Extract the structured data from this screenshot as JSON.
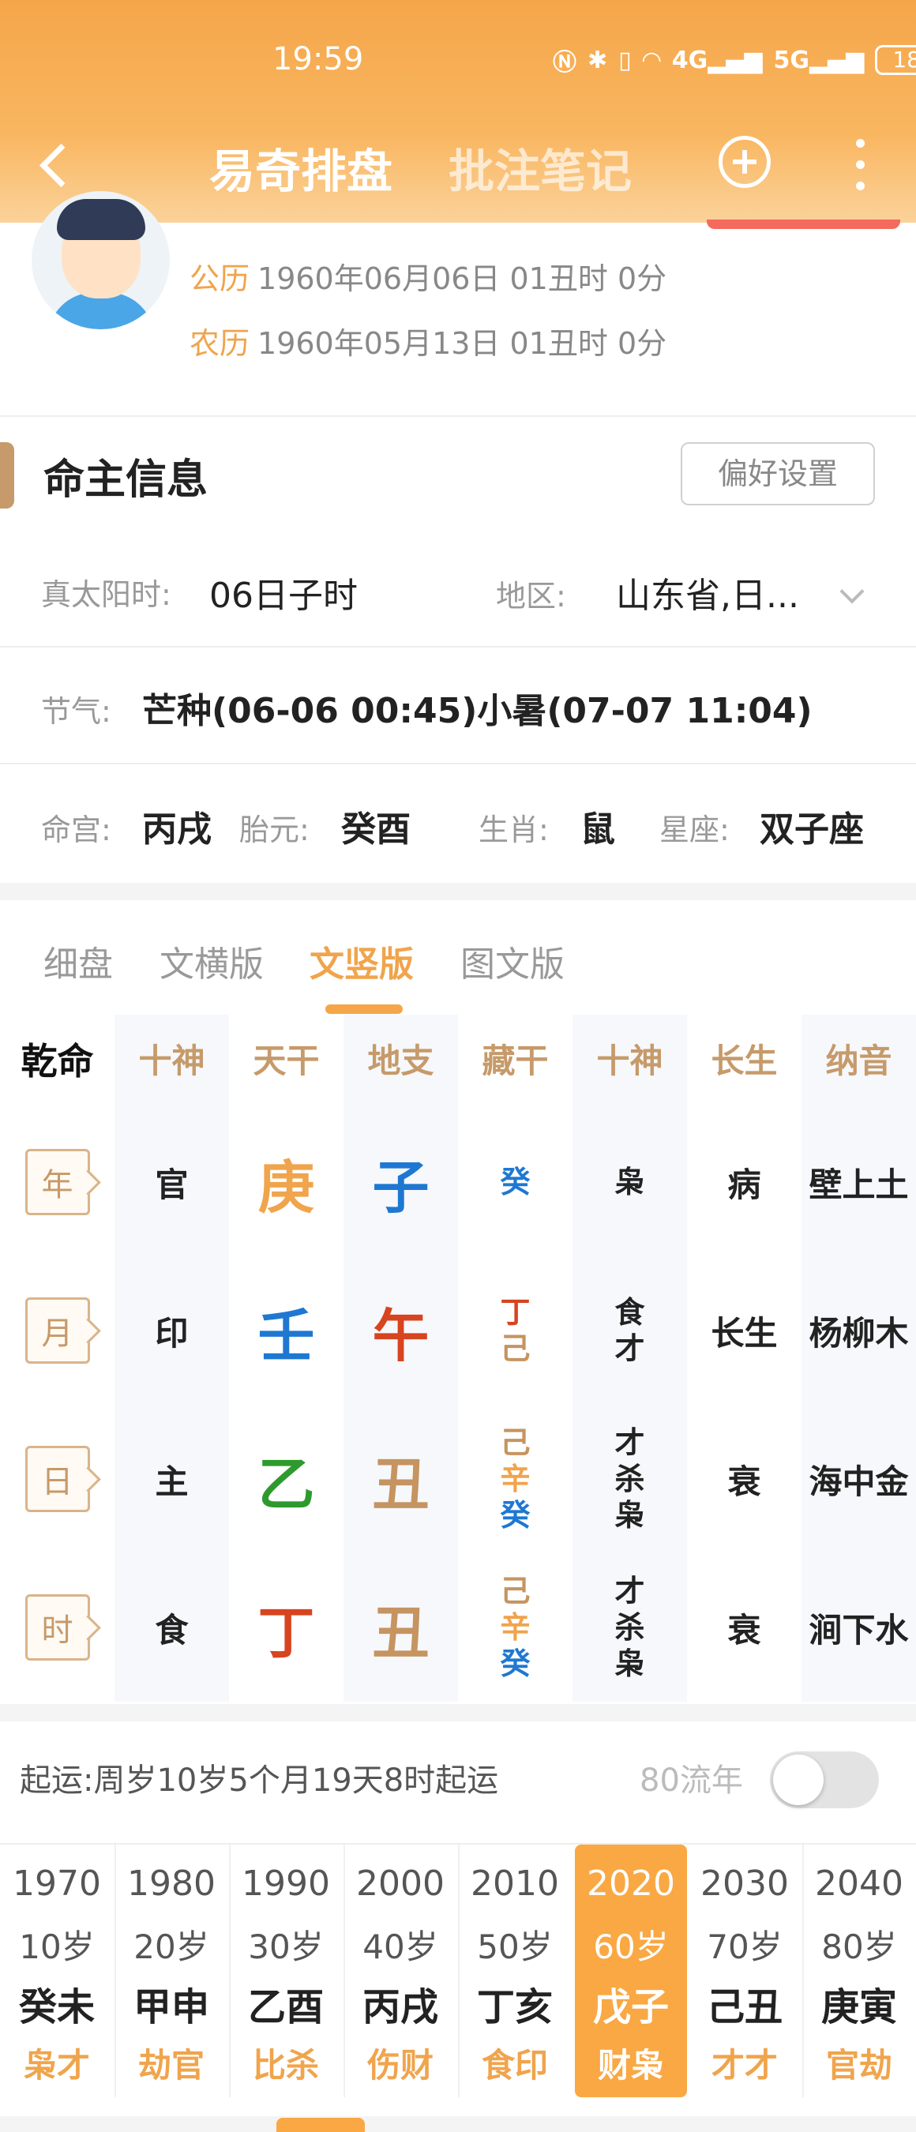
{
  "status_bar": {
    "time": "19:59",
    "icons": [
      "nfc-icon",
      "bluetooth-icon",
      "vibrate-icon",
      "wifi-icon",
      "4g-signal-icon",
      "5g-signal-icon"
    ],
    "battery": "18"
  },
  "navbar": {
    "tab_active": "易奇排盘",
    "tab_inactive": "批注笔记"
  },
  "calendar": {
    "solar_label": "公历",
    "solar_value": "1960年06月06日 01丑时 0分",
    "lunar_label": "农历",
    "lunar_value": "1960年05月13日 01丑时 0分"
  },
  "info": {
    "title": "命主信息",
    "pref_button": "偏好设置",
    "true_solar_label": "真太阳时:",
    "true_solar_value": "06日子时",
    "region_label": "地区:",
    "region_value": "山东省,日...",
    "jieqi_label": "节气:",
    "jieqi_value": "芒种(06-06 00:45)小暑(07-07 11:04)",
    "minggong_label": "命宫:",
    "minggong_value": "丙戌",
    "taiyuan_label": "胎元:",
    "taiyuan_value": "癸酉",
    "shengxiao_label": "生肖:",
    "shengxiao_value": "鼠",
    "xingzuo_label": "星座:",
    "xingzuo_value": "双子座"
  },
  "view_tabs": [
    "细盘",
    "文横版",
    "文竖版",
    "图文版"
  ],
  "active_view_tab": "文竖版",
  "pillars": {
    "corner": "乾命",
    "headers": [
      "十神",
      "天干",
      "地支",
      "藏干",
      "十神",
      "长生",
      "纳音"
    ],
    "rows": [
      {
        "pillar": "年",
        "shishen": "官",
        "tiangan": "庚",
        "dizhi": "子",
        "canggan": [
          "癸"
        ],
        "zhi_shishen": [
          "枭"
        ],
        "changsheng": "病",
        "nayin": "壁上土"
      },
      {
        "pillar": "月",
        "shishen": "印",
        "tiangan": "壬",
        "dizhi": "午",
        "canggan": [
          "丁",
          "己"
        ],
        "zhi_shishen": [
          "食",
          "才"
        ],
        "changsheng": "长生",
        "nayin": "杨柳木"
      },
      {
        "pillar": "日",
        "shishen": "主",
        "tiangan": "乙",
        "dizhi": "丑",
        "canggan": [
          "己",
          "辛",
          "癸"
        ],
        "zhi_shishen": [
          "才",
          "杀",
          "枭"
        ],
        "changsheng": "衰",
        "nayin": "海中金"
      },
      {
        "pillar": "时",
        "shishen": "食",
        "tiangan": "丁",
        "dizhi": "丑",
        "canggan": [
          "己",
          "辛",
          "癸"
        ],
        "zhi_shishen": [
          "才",
          "杀",
          "枭"
        ],
        "changsheng": "衰",
        "nayin": "涧下水"
      }
    ],
    "colors": {
      "gold": "#c69a6a",
      "blue": "#1e78d2",
      "orange": "#f0a44c",
      "red": "#d7441f",
      "green": "#2e9a2e"
    }
  },
  "qiyun": {
    "label": "起运:",
    "value": "周岁10岁5个月19天8时起运",
    "liunian_label": "80流年",
    "toggle_on": false
  },
  "dayun": [
    {
      "year": "1970",
      "age": "10岁",
      "ganzhi": "癸未",
      "shishen": "枭才"
    },
    {
      "year": "1980",
      "age": "20岁",
      "ganzhi": "甲申",
      "shishen": "劫官"
    },
    {
      "year": "1990",
      "age": "30岁",
      "ganzhi": "乙酉",
      "shishen": "比杀"
    },
    {
      "year": "2000",
      "age": "40岁",
      "ganzhi": "丙戌",
      "shishen": "伤财"
    },
    {
      "year": "2010",
      "age": "50岁",
      "ganzhi": "丁亥",
      "shishen": "食印"
    },
    {
      "year": "2020",
      "age": "60岁",
      "ganzhi": "戊子",
      "shishen": "财枭"
    },
    {
      "year": "2030",
      "age": "70岁",
      "ganzhi": "己丑",
      "shishen": "才才"
    },
    {
      "year": "2040",
      "age": "80岁",
      "ganzhi": "庚寅",
      "shishen": "官劫"
    }
  ],
  "dayun_active_index": 5,
  "theme": {
    "accent": "#f5a64a",
    "accent_text": "#f0a44c"
  }
}
